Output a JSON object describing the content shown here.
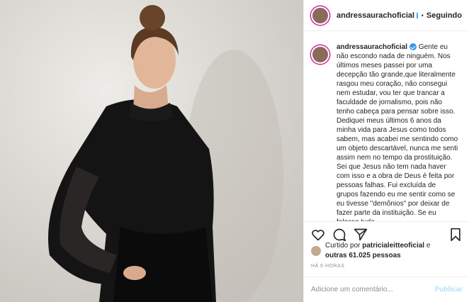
{
  "post": {
    "header": {
      "username": "andressaurachoficial",
      "separator": "•",
      "follow_label": "Seguindo"
    },
    "caption": {
      "username": "andressaurachoficial",
      "text": "Gente eu não escondo nada de ninguém. Nos últimos meses passei por uma decepção tão grande,que literalmente rasgou meu coração, não consegui nem estudar, vou ter que trancar a faculdade de jornalismo, pois não tenho cabeça para pensar sobre isso. Dediquei meus últimos 6 anos da minha vida para Jesus como todos sabem, mas acabei me sentindo como um objeto descartável, nunca me senti assim nem no tempo da prostituição. Sei que Jesus não tem nada haver com isso e a obra de Deus é feita por pessoas falhas. Fui excluída de grupos fazendo eu me sentir como se eu tivesse \"demônios\" por deixar de fazer parte da instituição. Se eu falasse tudo"
    },
    "likes": {
      "prefix": "Curtido por",
      "first_user": "patricialeitteoficial",
      "conjunction": "e",
      "others": "outras 61.025 pessoas"
    },
    "time_ago": "HÁ 6 HORAS",
    "comment": {
      "placeholder": "Adicione um comentário...",
      "publish_label": "Publicar"
    },
    "icons": [
      "heart-icon",
      "comment-icon",
      "share-icon",
      "bookmark-icon"
    ],
    "colors": {
      "verified": "#3897f0",
      "publish_disabled": "#b2dffc",
      "ring": "#d6249f"
    }
  }
}
